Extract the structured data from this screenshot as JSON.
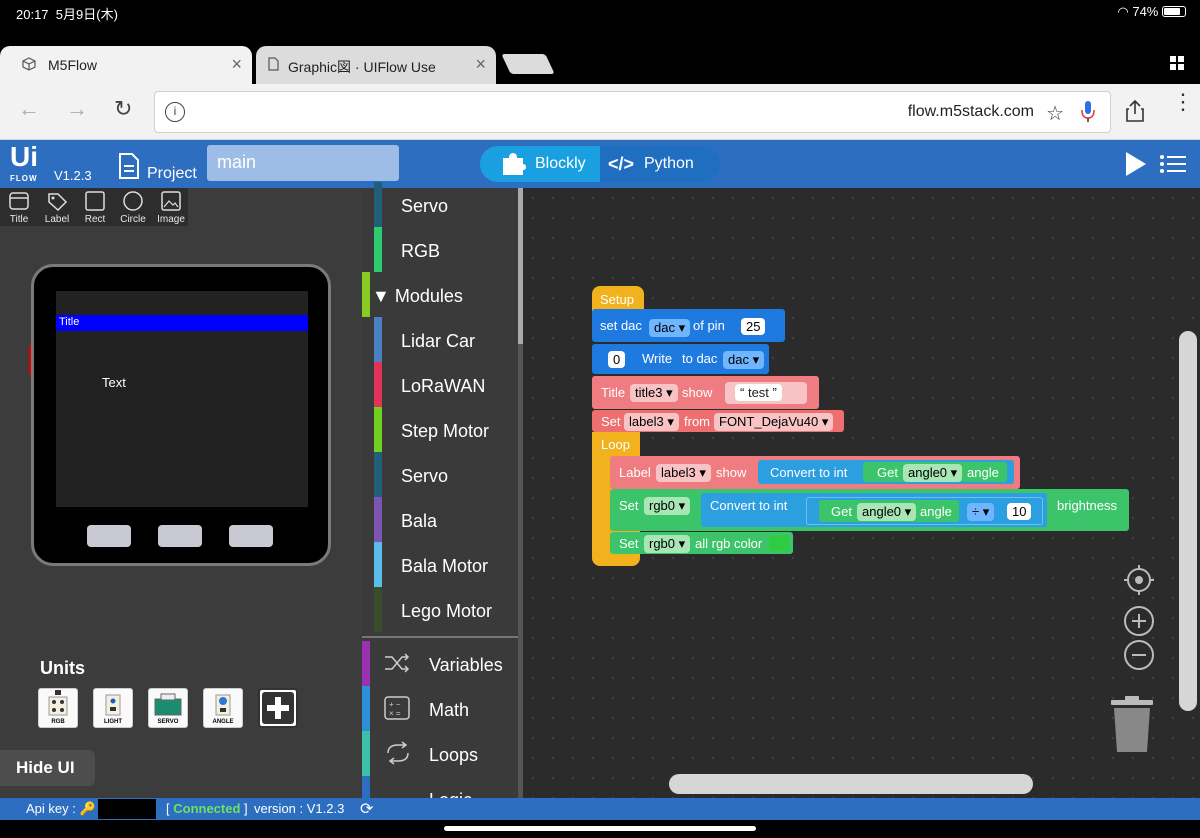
{
  "status_bar": {
    "time": "20:17",
    "date": "5月9日(木)",
    "battery": "74%"
  },
  "browser": {
    "tabs": [
      {
        "title": "M5Flow",
        "close": "×"
      },
      {
        "title": "Graphic図 · UIFlow Use",
        "close": "×"
      }
    ],
    "url": "flow.m5stack.com",
    "info_glyph": "i"
  },
  "uiflow": {
    "logo_top": "Ui",
    "logo_bottom": "FLOW",
    "version": "V1.2.3",
    "project_label": "Project",
    "project_name": "main",
    "mode_blockly": "Blockly",
    "mode_python": "Python"
  },
  "ui_tools": [
    "Title",
    "Label",
    "Rect",
    "Circle",
    "Image"
  ],
  "device": {
    "title_text": "Title",
    "label_text": "Text"
  },
  "units": {
    "heading": "Units",
    "items": [
      "RGB",
      "LIGHT",
      "SERVO",
      "ANGLE"
    ]
  },
  "hide_ui": "Hide UI",
  "categories": [
    {
      "label": "Servo",
      "color": "#1f5f7a"
    },
    {
      "label": "RGB",
      "color": "#2ecc71"
    },
    {
      "label": "Modules",
      "color": "#88cc22",
      "expanded": true
    },
    {
      "label": "Lidar Car",
      "color": "#4a7fc0"
    },
    {
      "label": "LoRaWAN",
      "color": "#e0335a"
    },
    {
      "label": "Step Motor",
      "color": "#6fd020"
    },
    {
      "label": "Servo",
      "color": "#1f5f7a"
    },
    {
      "label": "Bala",
      "color": "#7b55b0"
    },
    {
      "label": "Bala Motor",
      "color": "#5bbde8"
    },
    {
      "label": "Lego Motor",
      "color": "#3a4d2a"
    },
    {
      "label": "Variables",
      "color": "#9b30b0"
    },
    {
      "label": "Math",
      "color": "#2c8fd8"
    },
    {
      "label": "Loops",
      "color": "#3cc0a8"
    },
    {
      "label": "Logic",
      "color": "#2c6fc0"
    }
  ],
  "blocks": {
    "setup": "Setup",
    "set_dac": "set dac",
    "dac": "dac",
    "of_pin": "of pin",
    "pin_value": "25",
    "write_value": "0",
    "write": "Write",
    "to_dac": "to dac",
    "dac2": "dac",
    "title_kw": "Title",
    "title3": "title3",
    "show": "show",
    "test": "test",
    "set_kw": "Set",
    "label3": "label3",
    "from": "from",
    "font": "FONT_DejaVu40",
    "loop": "Loop",
    "label_kw": "Label",
    "label3b": "label3",
    "show2": "show",
    "convert": "Convert to int",
    "get": "Get",
    "angle0": "angle0",
    "angle": "angle",
    "set_rgb": "Set",
    "rgb0": "rgb0",
    "convert2": "Convert to int",
    "get2": "Get",
    "angle0b": "angle0",
    "angle2": "angle",
    "div": "÷",
    "ten": "10",
    "brightness": "brightness",
    "set_rgb2": "Set",
    "rgb0b": "rgb0",
    "all_rgb": "all rgb color",
    "rgb_color": "#2ecc40"
  },
  "footer": {
    "api_key": "Api key :",
    "connected": "Connected",
    "version": "version : V1.2.3"
  }
}
